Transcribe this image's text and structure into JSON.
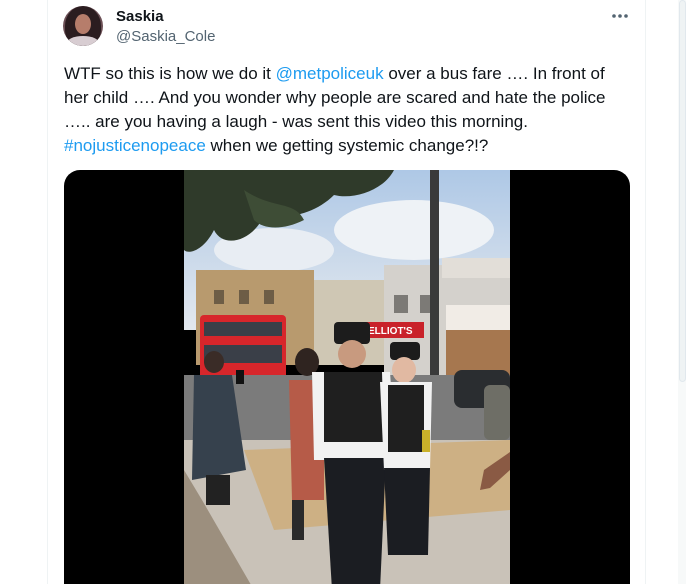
{
  "author": {
    "name": "Saskia",
    "handle": "@Saskia_Cole",
    "avatar_icon": "profile-photo"
  },
  "more_icon": "ellipsis-icon",
  "tweet": {
    "part1": "WTF so this is how we do it ",
    "mention": "@metpoliceuk",
    "part2": " over a bus fare …. In front of her child …. And you wonder why people are scared and hate the police ….. are you having a laugh - was sent this video this morning. ",
    "hashtag": "#nojusticenopeace",
    "part3": " when we getting systemic change?!?"
  },
  "media": {
    "shop_sign": "ELLIOT'S",
    "colors": {
      "link": "#1d9bf0",
      "bus": "#d7262b",
      "sky": "#c6d6ea"
    }
  }
}
